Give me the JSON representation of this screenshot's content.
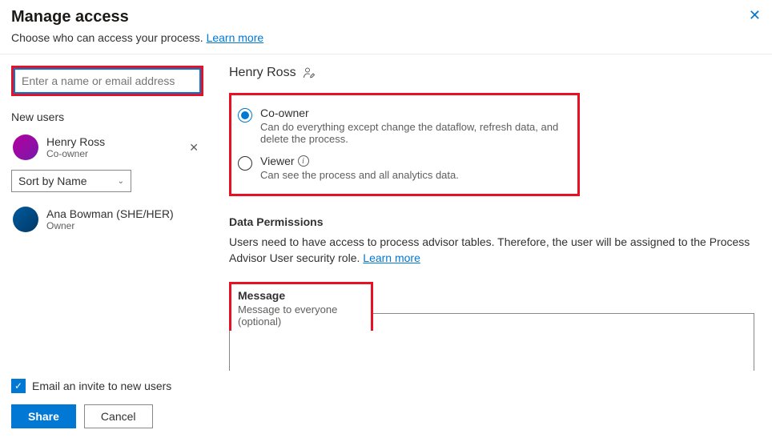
{
  "header": {
    "title": "Manage access",
    "subtitle": "Choose who can access your process.",
    "learn_more": "Learn more"
  },
  "left": {
    "search_placeholder": "Enter a name or email address",
    "new_users_label": "New users",
    "new_users": [
      {
        "name": "Henry Ross",
        "role": "Co-owner"
      }
    ],
    "sort_label": "Sort by Name",
    "existing_users": [
      {
        "name": "Ana Bowman (SHE/HER)",
        "role": "Owner"
      }
    ]
  },
  "right": {
    "selected_user": "Henry Ross",
    "roles": [
      {
        "title": "Co-owner",
        "desc": "Can do everything except change the dataflow, refresh data, and delete the process.",
        "checked": true,
        "info": false
      },
      {
        "title": "Viewer",
        "desc": "Can see the process and all analytics data.",
        "checked": false,
        "info": true
      }
    ],
    "permissions": {
      "title": "Data Permissions",
      "text": "Users need to have access to process advisor tables. Therefore, the user will be assigned to the Process Advisor User security role.",
      "learn_more": "Learn more"
    },
    "message": {
      "label": "Message",
      "placeholder": "Message to everyone (optional)"
    }
  },
  "footer": {
    "email_invite": "Email an invite to new users",
    "share": "Share",
    "cancel": "Cancel"
  }
}
